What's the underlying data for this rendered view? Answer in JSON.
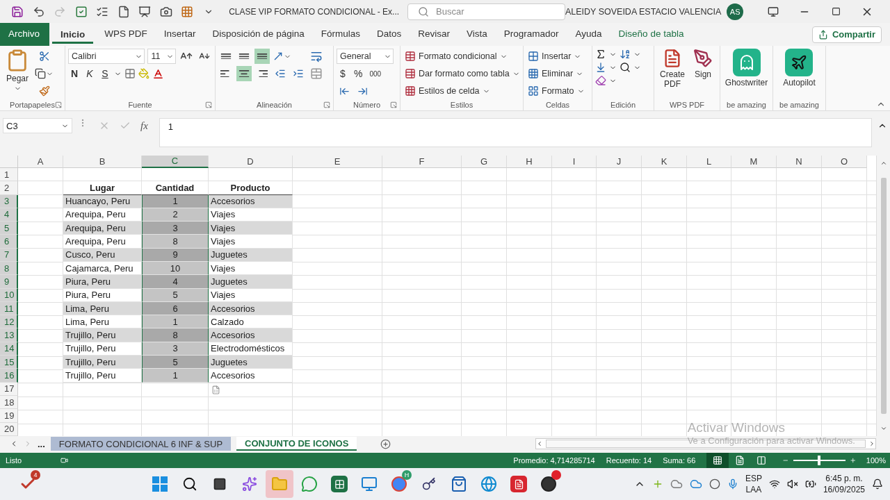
{
  "title_bar": {
    "title": "CLASE VIP FORMATO CONDICIONAL  -  Ex...",
    "search_placeholder": "Buscar",
    "user": "ALEIDY SOVEIDA ESTACIO VALENCIA",
    "avatar": "AS"
  },
  "menu_tabs": [
    {
      "label": "Archivo",
      "kind": "file",
      "selected": false
    },
    {
      "label": "Inicio",
      "kind": "normal",
      "selected": true
    },
    {
      "label": "WPS PDF",
      "kind": "normal",
      "selected": false
    },
    {
      "label": "Insertar",
      "kind": "normal",
      "selected": false
    },
    {
      "label": "Disposición de página",
      "kind": "normal",
      "selected": false
    },
    {
      "label": "Fórmulas",
      "kind": "normal",
      "selected": false
    },
    {
      "label": "Datos",
      "kind": "normal",
      "selected": false
    },
    {
      "label": "Revisar",
      "kind": "normal",
      "selected": false
    },
    {
      "label": "Vista",
      "kind": "normal",
      "selected": false
    },
    {
      "label": "Programador",
      "kind": "normal",
      "selected": false
    },
    {
      "label": "Ayuda",
      "kind": "normal",
      "selected": false
    },
    {
      "label": "Diseño de tabla",
      "kind": "contextual",
      "selected": false
    }
  ],
  "share_button": "Compartir",
  "ribbon": {
    "clipboard": {
      "paste": "Pegar",
      "label": "Portapapeles"
    },
    "font": {
      "name": "Calibri",
      "size": "11",
      "bold": "N",
      "italic": "K",
      "underline": "S",
      "label": "Fuente"
    },
    "alignment": {
      "vertical": [
        {
          "selected": false
        },
        {
          "selected": false
        },
        {
          "selected": true
        }
      ],
      "horizontal": [
        {
          "selected": false
        },
        {
          "selected": true
        },
        {
          "selected": false
        }
      ],
      "label": "Alineación"
    },
    "number": {
      "format": "General",
      "currency": "$",
      "percent": "%",
      "thousands": "000",
      "label": "Número"
    },
    "styles": {
      "items": [
        "Formato condicional",
        "Dar formato como tabla",
        "Estilos de celda"
      ],
      "label": "Estilos"
    },
    "cells": {
      "items": [
        "Insertar",
        "Eliminar",
        "Formato"
      ],
      "label": "Celdas"
    },
    "editing": {
      "label": "Edición"
    },
    "wps": {
      "create": "Create PDF",
      "sign": "Sign",
      "label": "WPS PDF"
    },
    "addins": [
      {
        "name": "Ghostwriter",
        "label": "be amazing",
        "kind": "ghost"
      },
      {
        "name": "Autopilot",
        "label": "be amazing",
        "kind": "plane"
      }
    ]
  },
  "formula_bar": {
    "name_box": "C3",
    "function_label": "fx",
    "value": "1"
  },
  "sheet": {
    "columns": [
      {
        "label": "A",
        "selected": false
      },
      {
        "label": "B",
        "selected": false
      },
      {
        "label": "C",
        "selected": true
      },
      {
        "label": "D",
        "selected": false
      },
      {
        "label": "E",
        "selected": false
      },
      {
        "label": "F",
        "selected": false
      },
      {
        "label": "G",
        "selected": false
      },
      {
        "label": "H",
        "selected": false
      },
      {
        "label": "I",
        "selected": false
      },
      {
        "label": "J",
        "selected": false
      },
      {
        "label": "K",
        "selected": false
      },
      {
        "label": "L",
        "selected": false
      },
      {
        "label": "M",
        "selected": false
      },
      {
        "label": "N",
        "selected": false
      },
      {
        "label": "O",
        "selected": false
      }
    ],
    "rows": [
      {
        "number": "1",
        "kind": "empty",
        "selected": false
      },
      {
        "number": "2",
        "kind": "header",
        "selected": false,
        "cells": [
          "Lugar",
          "Cantidad",
          "Producto"
        ]
      },
      {
        "number": "3",
        "kind": "data",
        "selected": true,
        "shaded": true,
        "cells": [
          "Huancayo, Peru",
          "1",
          "Accesorios"
        ]
      },
      {
        "number": "4",
        "kind": "data",
        "selected": true,
        "shaded": false,
        "cells": [
          "Arequipa, Peru",
          "2",
          "Viajes"
        ]
      },
      {
        "number": "5",
        "kind": "data",
        "selected": true,
        "shaded": true,
        "cells": [
          "Arequipa, Peru",
          "3",
          "Viajes"
        ]
      },
      {
        "number": "6",
        "kind": "data",
        "selected": true,
        "shaded": false,
        "cells": [
          "Arequipa, Peru",
          "8",
          "Viajes"
        ]
      },
      {
        "number": "7",
        "kind": "data",
        "selected": true,
        "shaded": true,
        "cells": [
          "Cusco, Peru",
          "9",
          "Juguetes"
        ]
      },
      {
        "number": "8",
        "kind": "data",
        "selected": true,
        "shaded": false,
        "cells": [
          "Cajamarca, Peru",
          "10",
          "Viajes"
        ]
      },
      {
        "number": "9",
        "kind": "data",
        "selected": true,
        "shaded": true,
        "cells": [
          "Piura, Peru",
          "4",
          "Juguetes"
        ]
      },
      {
        "number": "10",
        "kind": "data",
        "selected": true,
        "shaded": false,
        "cells": [
          "Piura, Peru",
          "5",
          "Viajes"
        ]
      },
      {
        "number": "11",
        "kind": "data",
        "selected": true,
        "shaded": true,
        "cells": [
          "Lima, Peru",
          "6",
          "Accesorios"
        ]
      },
      {
        "number": "12",
        "kind": "data",
        "selected": true,
        "shaded": false,
        "cells": [
          "Lima, Peru",
          "1",
          "Calzado"
        ]
      },
      {
        "number": "13",
        "kind": "data",
        "selected": true,
        "shaded": true,
        "cells": [
          "Trujillo, Peru",
          "8",
          "Accesorios"
        ]
      },
      {
        "number": "14",
        "kind": "data",
        "selected": true,
        "shaded": false,
        "cells": [
          "Trujillo, Peru",
          "3",
          "Electrodomésticos"
        ]
      },
      {
        "number": "15",
        "kind": "data",
        "selected": true,
        "shaded": true,
        "cells": [
          "Trujillo, Peru",
          "5",
          "Juguetes"
        ]
      },
      {
        "number": "16",
        "kind": "data",
        "selected": true,
        "shaded": false,
        "cells": [
          "Trujillo, Peru",
          "1",
          "Accesorios"
        ]
      },
      {
        "number": "17",
        "kind": "empty",
        "selected": false
      },
      {
        "number": "18",
        "kind": "empty",
        "selected": false
      },
      {
        "number": "19",
        "kind": "empty",
        "selected": false
      },
      {
        "number": "20",
        "kind": "empty",
        "selected": false
      }
    ]
  },
  "activation_notice": {
    "title": "Activar Windows",
    "text": "Ve a Configuración para activar Windows."
  },
  "sheet_tabs": {
    "more": "...",
    "tabs": [
      {
        "label": "FORMATO CONDICIONAL 6 INF & SUP",
        "selected": false
      },
      {
        "label": "CONJUNTO DE ICONOS",
        "selected": true
      }
    ]
  },
  "status_bar": {
    "status": "Listo",
    "stats": [
      "Promedio: 4,714285714",
      "Recuento: 14",
      "Suma: 66"
    ],
    "zoom": "100%",
    "zoom_level": {
      "level": 0.5
    }
  },
  "taskbar": {
    "notification_badge": "4",
    "browser_badge": "H",
    "language": [
      "ESP",
      "LAA"
    ],
    "time": "6:45 p. m.",
    "date": "16/09/2025"
  }
}
